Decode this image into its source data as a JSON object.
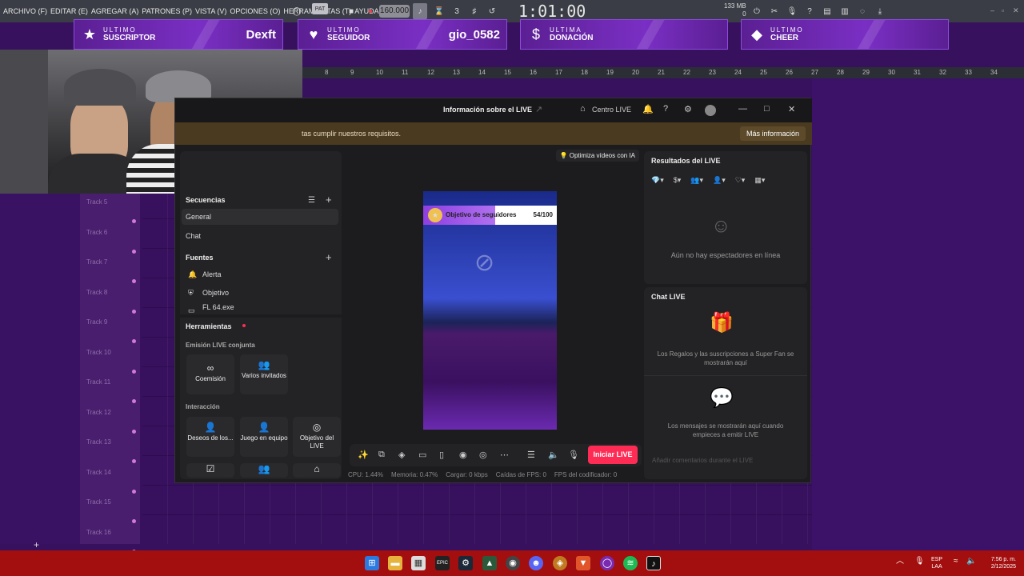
{
  "fl": {
    "menu": [
      "ARCHIVO (F)",
      "EDITAR (E)",
      "AGREGAR (A)",
      "PATRONES (P)",
      "VISTA (V)",
      "OPCIONES (O)",
      "HERRAMIENTAS (T)",
      "AYUDA"
    ],
    "bpm": "160.000",
    "time": "1:01:00",
    "memory": "133 MB",
    "memory_sub": "0",
    "ruler": [
      "8",
      "9",
      "10",
      "11",
      "12",
      "13",
      "14",
      "15",
      "16",
      "17",
      "18",
      "19",
      "20",
      "21",
      "22",
      "23",
      "24",
      "25",
      "26",
      "27",
      "28",
      "29",
      "30",
      "31",
      "32",
      "33",
      "34"
    ],
    "tracks": [
      "Track 5",
      "Track 6",
      "Track 7",
      "Track 8",
      "Track 9",
      "Track 10",
      "Track 11",
      "Track 12",
      "Track 13",
      "Track 14",
      "Track 15",
      "Track 16"
    ]
  },
  "banners": [
    {
      "small": "ULTIMO",
      "big": "SUSCRIPTOR",
      "name": "Dexft",
      "icon": "star-icon"
    },
    {
      "small": "ULTIMO",
      "big": "SEGUIDOR",
      "name": "gio_0582",
      "icon": "heart-icon"
    },
    {
      "small": "ULTIMA",
      "big": "DONACIÓN",
      "name": "",
      "icon": "dollar-icon"
    },
    {
      "small": "ULTIMO",
      "big": "CHEER",
      "name": "",
      "icon": "diamond-icon"
    }
  ],
  "studio": {
    "title": "Información sobre el LIVE",
    "centro": "Centro LIVE",
    "notice": "tas cumplir nuestros requisitos.",
    "notice_button": "Más información",
    "secuencias_title": "Secuencias",
    "secuencias": [
      "General",
      "Chat"
    ],
    "fuentes_title": "Fuentes",
    "fuentes": [
      "Alerta",
      "Objetivo",
      "FL 64.exe"
    ],
    "herramientas_title": "Herramientas",
    "emision_title": "Emisión LIVE conjunta",
    "emision_tools": [
      "Coemisión",
      "Varios invitados"
    ],
    "interaccion_title": "Interacción",
    "interaccion_tools": [
      "Deseos de los...",
      "Juego en equipo",
      "Objetivo del LIVE"
    ],
    "ia_button": "Optimiza vídeos con IA",
    "goal_label": "Objetivo de seguidores",
    "goal_count": "54/100",
    "goal_progress": 0.54,
    "go_live": "Iniciar LIVE",
    "stats": [
      "CPU: 1.44%",
      "Memoria: 0.47%",
      "Cargar: 0 kbps",
      "Caídas de FPS: 0",
      "FPS del codificador: 0"
    ],
    "results_title": "Resultados del LIVE",
    "no_viewers": "Aún no hay espectadores en línea",
    "chat_title": "Chat LIVE",
    "gifts_text": "Los Regalos y las suscripciones a Super Fan se mostrarán aquí",
    "messages_text": "Los mensajes se mostrarán aquí cuando empieces a emitir LIVE",
    "chat_placeholder": "Añadir comentarios durante el LIVE"
  },
  "taskbar": {
    "lang": "ESP",
    "lang2": "LAA",
    "time": "7:56 p. m.",
    "date": "2/12/2025"
  },
  "colors": {
    "accent": "#fe2c55",
    "fl_bg": "#37105e",
    "taskbar": "#a30e0e",
    "banner": "#7a2fc4"
  }
}
